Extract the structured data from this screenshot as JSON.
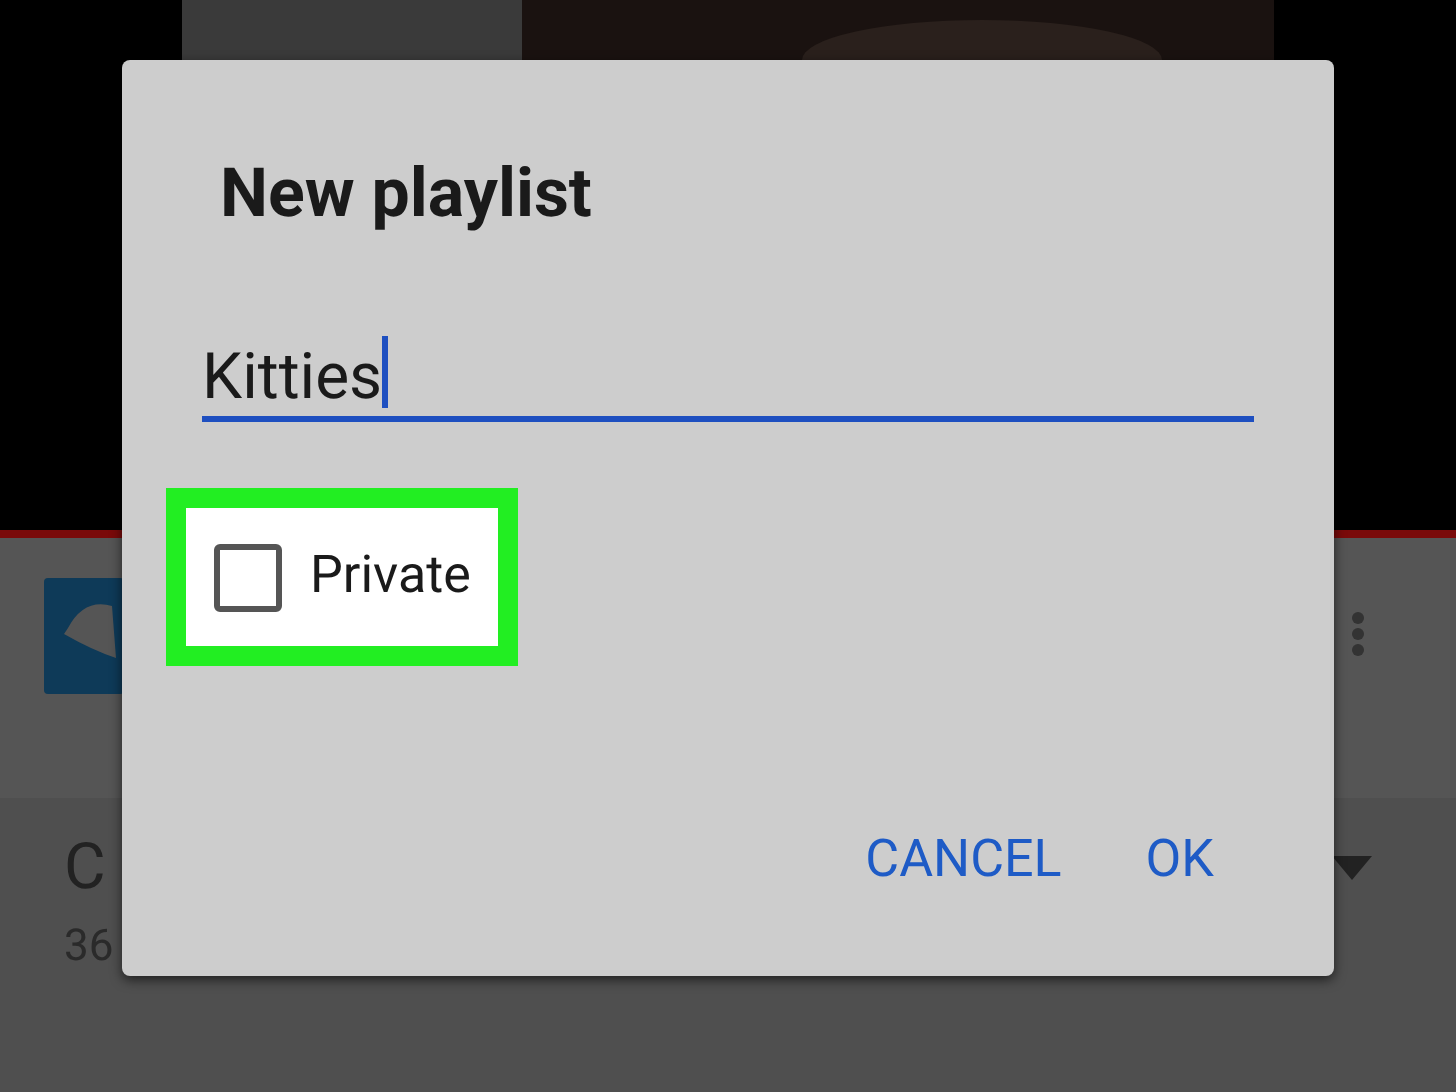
{
  "video_info": {
    "title": "C",
    "views": "36"
  },
  "dialog": {
    "title": "New playlist",
    "name_field": {
      "value": "Kitties",
      "focused": true
    },
    "private": {
      "label": "Private",
      "checked": false,
      "highlighted": true
    },
    "buttons": [
      "CANCEL",
      "OK"
    ]
  }
}
